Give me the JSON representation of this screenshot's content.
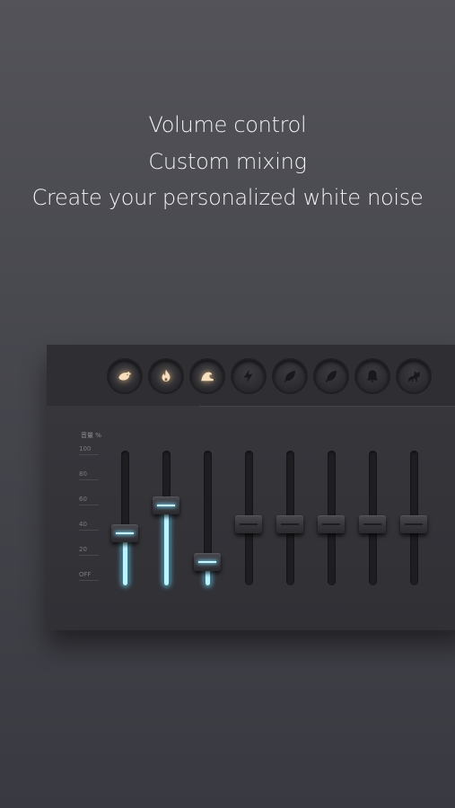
{
  "headline": {
    "line1": "Volume control",
    "line2": "Custom mixing",
    "line3": "Create your personalized white noise"
  },
  "mixer": {
    "scale_title": "音量 %",
    "scale": [
      "100",
      "80",
      "60",
      "40",
      "20",
      "OFF"
    ],
    "channels": [
      {
        "icon": "bird-icon",
        "active": true,
        "volume_percent": 38
      },
      {
        "icon": "fire-icon",
        "active": true,
        "volume_percent": 60
      },
      {
        "icon": "ocean-wave-icon",
        "active": true,
        "volume_percent": 15
      },
      {
        "icon": "lightning-icon",
        "active": false,
        "volume_percent": 45
      },
      {
        "icon": "leaf-icon",
        "active": false,
        "volume_percent": 45
      },
      {
        "icon": "feather-icon",
        "active": false,
        "volume_percent": 45
      },
      {
        "icon": "bell-icon",
        "active": false,
        "volume_percent": 45
      },
      {
        "icon": "cat-icon",
        "active": false,
        "volume_percent": 45
      }
    ]
  }
}
